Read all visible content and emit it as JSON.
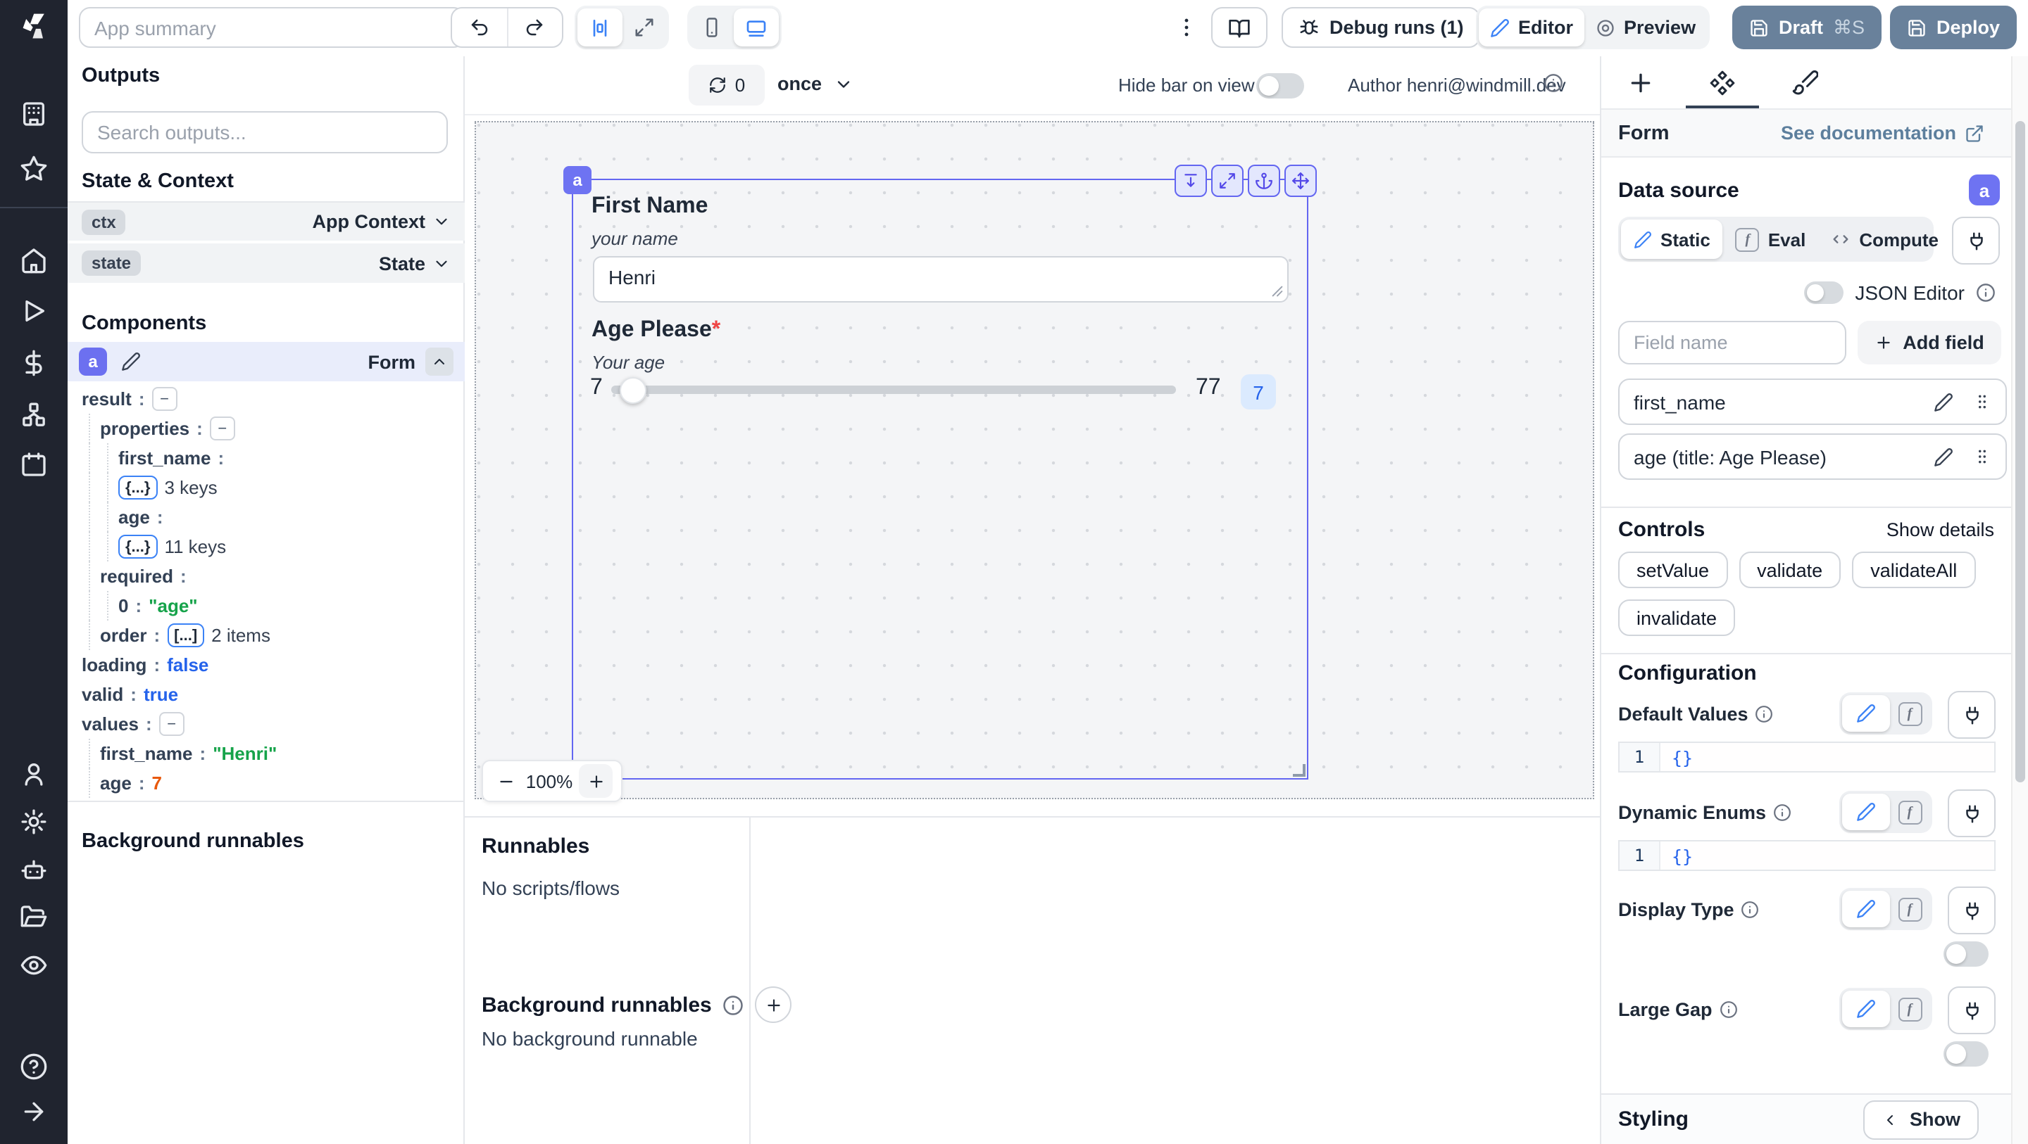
{
  "topbar": {
    "app_summary_placeholder": "App summary",
    "debug_runs_label": "Debug runs (1)",
    "editor_label": "Editor",
    "preview_label": "Preview",
    "draft_label": "Draft",
    "draft_shortcut": "⌘S",
    "deploy_label": "Deploy"
  },
  "outputs": {
    "title": "Outputs",
    "search_placeholder": "Search outputs...",
    "state_context_title": "State & Context",
    "ctx_badge": "ctx",
    "ctx_label": "App Context",
    "state_badge": "state",
    "state_label": "State",
    "components_title": "Components",
    "component_id": "a",
    "component_type": "Form",
    "background_runnables_title": "Background runnables",
    "tree": [
      {
        "ind": 0,
        "key": "result",
        "tok": "-"
      },
      {
        "ind": 1,
        "key": "properties",
        "tok": "-"
      },
      {
        "ind": 2,
        "key": "first_name"
      },
      {
        "ind": 2,
        "tok": "{...}",
        "suf": "3 keys"
      },
      {
        "ind": 2,
        "key": "age"
      },
      {
        "ind": 2,
        "tok": "{...}",
        "suf": "11 keys"
      },
      {
        "ind": 1,
        "key": "required"
      },
      {
        "ind": 2,
        "key": "0",
        "val": "\"age\"",
        "vcls": "string"
      },
      {
        "ind": 1,
        "key": "order",
        "tok": "[...]",
        "suf": "2 items"
      },
      {
        "ind": 0,
        "key": "loading",
        "val": "false",
        "vcls": "bool"
      },
      {
        "ind": 0,
        "key": "valid",
        "val": "true",
        "vcls": "bool"
      },
      {
        "ind": 0,
        "key": "values",
        "tok": "-"
      },
      {
        "ind": 1,
        "key": "first_name",
        "val": "\"Henri\"",
        "vcls": "string"
      },
      {
        "ind": 1,
        "key": "age",
        "val": "7",
        "vcls": "number"
      }
    ]
  },
  "canvas": {
    "refresh_count": "0",
    "run_mode": "once",
    "hide_bar_label": "Hide bar on view",
    "author_label": "Author henri@windmill.dev",
    "component_tag": "a",
    "zoom_level": "100%",
    "form": {
      "field1_label": "First Name",
      "field1_desc": "your name",
      "field1_value": "Henri",
      "field2_label": "Age Please",
      "field2_required_mark": "*",
      "field2_desc": "Your age",
      "slider_min": "7",
      "slider_max": "77",
      "slider_value": "7"
    }
  },
  "runnables": {
    "title": "Runnables",
    "empty_label": "No scripts/flows",
    "background_title": "Background runnables",
    "background_empty_label": "No background runnable"
  },
  "settings": {
    "component_type": "Form",
    "doc_link_label": "See documentation",
    "data_source_label": "Data source",
    "component_badge": "a",
    "modes": [
      "Static",
      "Eval",
      "Compute"
    ],
    "json_editor_label": "JSON Editor",
    "field_name_placeholder": "Field name",
    "add_field_label": "Add field",
    "fields": [
      {
        "label": "first_name"
      },
      {
        "label": "age (title: Age Please)"
      }
    ],
    "controls_title": "Controls",
    "show_details_label": "Show details",
    "control_pills": [
      "setValue",
      "validate",
      "validateAll",
      "invalidate"
    ],
    "configuration_title": "Configuration",
    "code_line_number": "1",
    "config_items": [
      {
        "label": "Default Values",
        "editor": "{}"
      },
      {
        "label": "Dynamic Enums",
        "editor": "{}"
      },
      {
        "label": "Display Type",
        "toggle": true
      },
      {
        "label": "Large Gap",
        "toggle": true
      }
    ],
    "styling_title": "Styling",
    "show_button_label": "Show"
  },
  "colors": {
    "accent_indigo": "#6366f1",
    "accent_blue": "#3b82f6",
    "slate_button": "#69819b",
    "link_blue": "#5d7f9d",
    "string_green": "#16a34a",
    "bool_blue": "#2563eb",
    "number_orange": "#e8590c"
  }
}
